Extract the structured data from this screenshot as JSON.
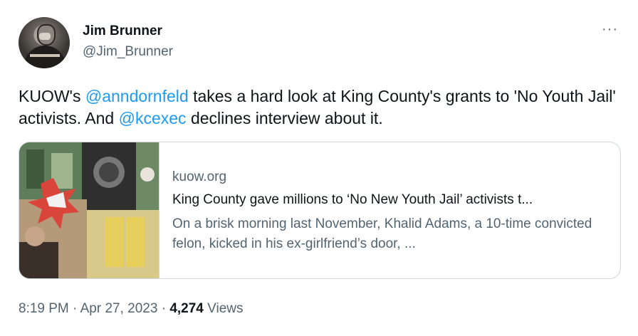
{
  "author": {
    "name": "Jim Brunner",
    "handle": "@Jim_Brunner"
  },
  "more_icon": "···",
  "tweet": {
    "part1": "KUOW's ",
    "mention1": "@anndornfeld",
    "part2": " takes a hard look at King County's grants to 'No Youth Jail' activists. And ",
    "mention2": "@kcexec",
    "part3": " declines interview about it."
  },
  "card": {
    "domain": "kuow.org",
    "title": "King County gave millions to ‘No New Youth Jail’ activists t...",
    "description": "On a brisk morning last November, Khalid Adams, a 10-time convicted felon, kicked in his ex-girlfriend’s door, ..."
  },
  "meta": {
    "time": "8:19 PM",
    "sep1": " · ",
    "date": "Apr 27, 2023",
    "sep2": " · ",
    "views_count": "4,274",
    "views_label": " Views"
  },
  "colors": {
    "link": "#1d9bf0",
    "secondary_text": "#536471",
    "primary_text": "#0f1419"
  }
}
